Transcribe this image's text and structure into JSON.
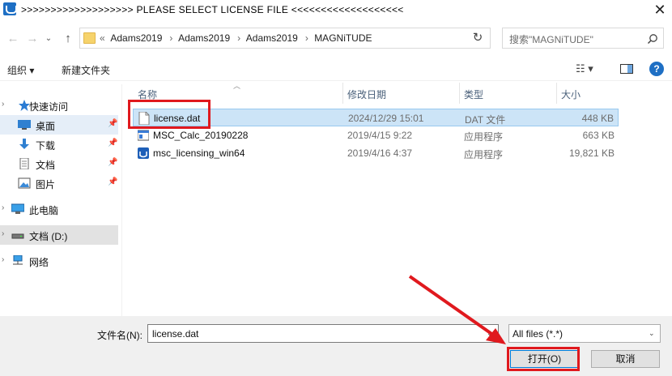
{
  "window": {
    "title": ">>>>>>>>>>>>>>>>>>>  PLEASE SELECT LICENSE FILE  <<<<<<<<<<<<<<<<<<<",
    "close_glyph": "✕"
  },
  "nav": {
    "back_glyph": "←",
    "forward_glyph": "→",
    "history_glyph": "⌄",
    "up_glyph": "↑",
    "breadcrumb_prefix": "«",
    "breadcrumbs": [
      "Adams2019",
      "Adams2019",
      "Adams2019",
      "MAGNiTUDE"
    ],
    "breadcrumb_sep": "›",
    "refresh_glyph": "↻",
    "search_placeholder": "搜索\"MAGNiTUDE\""
  },
  "toolbar": {
    "organize_label": "组织 ▾",
    "new_folder_label": "新建文件夹",
    "view_glyph": "☷ ▾",
    "help_glyph": "?"
  },
  "sidebar": {
    "items": [
      {
        "label": "快速访问",
        "icon": "star-icon",
        "expander": "›"
      },
      {
        "label": "桌面",
        "icon": "desktop-icon",
        "pinned": true
      },
      {
        "label": "下载",
        "icon": "download-icon",
        "pinned": true
      },
      {
        "label": "文档",
        "icon": "document-icon",
        "pinned": true
      },
      {
        "label": "图片",
        "icon": "picture-icon",
        "pinned": true
      },
      {
        "label": "此电脑",
        "icon": "computer-icon",
        "expander": "›"
      },
      {
        "label": "文档 (D:)",
        "icon": "drive-icon",
        "expander": "›"
      },
      {
        "label": "网络",
        "icon": "network-icon",
        "expander": "›"
      }
    ],
    "pin_glyph": "📌"
  },
  "filelist": {
    "columns": {
      "name": "名称",
      "date": "修改日期",
      "type": "类型",
      "size": "大小"
    },
    "rows": [
      {
        "name": "license.dat",
        "date": "2024/12/29 15:01",
        "type": "DAT 文件",
        "size": "448 KB",
        "icon": "file-icon",
        "selected": true
      },
      {
        "name": "MSC_Calc_20190228",
        "date": "2019/4/15 9:22",
        "type": "应用程序",
        "size": "663 KB",
        "icon": "app-icon"
      },
      {
        "name": "msc_licensing_win64",
        "date": "2019/4/16 4:37",
        "type": "应用程序",
        "size": "19,821 KB",
        "icon": "msc-app-icon"
      }
    ]
  },
  "bottom": {
    "filename_label": "文件名(N):",
    "filename_value": "license.dat",
    "filter_value": "All files (*.*)",
    "open_label": "打开(O)",
    "cancel_label": "取消",
    "dropdown_glyph": "⌄"
  },
  "colors": {
    "accent": "#0078d7",
    "selection": "#cce4f7",
    "annotation_red": "#e0191e"
  }
}
